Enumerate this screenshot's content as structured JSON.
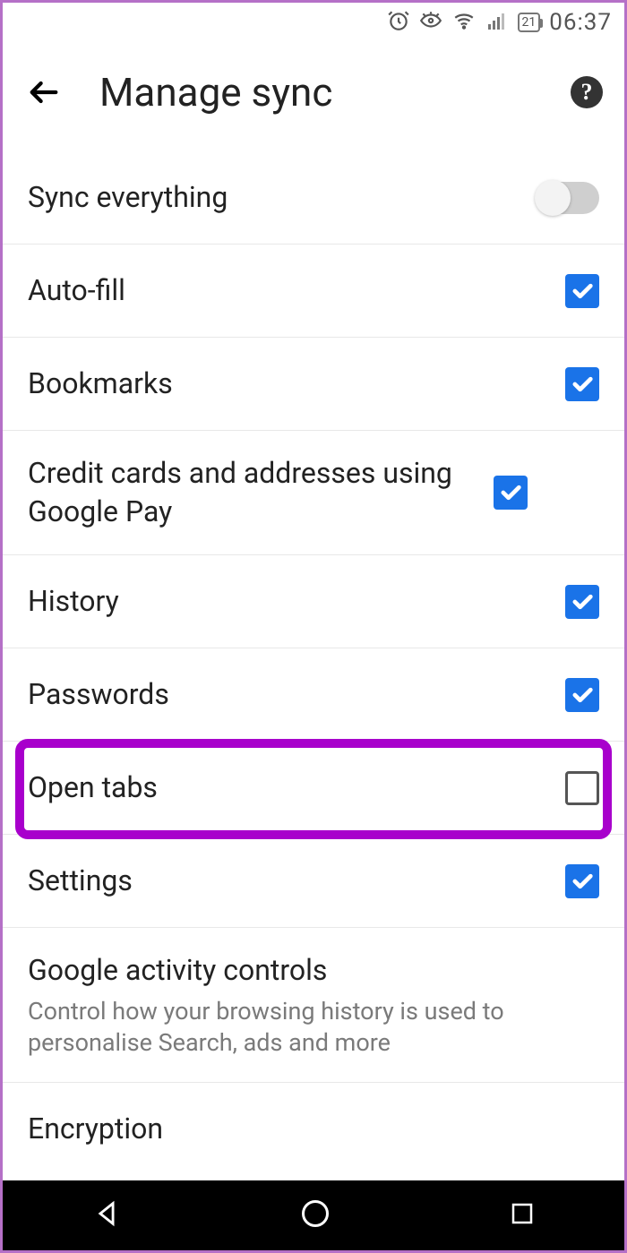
{
  "status": {
    "battery_text": "21",
    "time": "06:37"
  },
  "header": {
    "title": "Manage sync"
  },
  "rows": {
    "sync_everything": {
      "label": "Sync everything",
      "on": false
    },
    "autofill": {
      "label": "Auto-fill",
      "checked": true
    },
    "bookmarks": {
      "label": "Bookmarks",
      "checked": true
    },
    "creditcards": {
      "label": "Credit cards and addresses using Google Pay",
      "checked": true
    },
    "history": {
      "label": "History",
      "checked": true
    },
    "passwords": {
      "label": "Passwords",
      "checked": true
    },
    "open_tabs": {
      "label": "Open tabs",
      "checked": false
    },
    "settings": {
      "label": "Settings",
      "checked": true
    },
    "activity": {
      "label": "Google activity controls",
      "sub": "Control how your browsing history is used to personalise Search, ads and more"
    },
    "encryption": {
      "label": "Encryption"
    }
  },
  "highlight_row": "open_tabs"
}
